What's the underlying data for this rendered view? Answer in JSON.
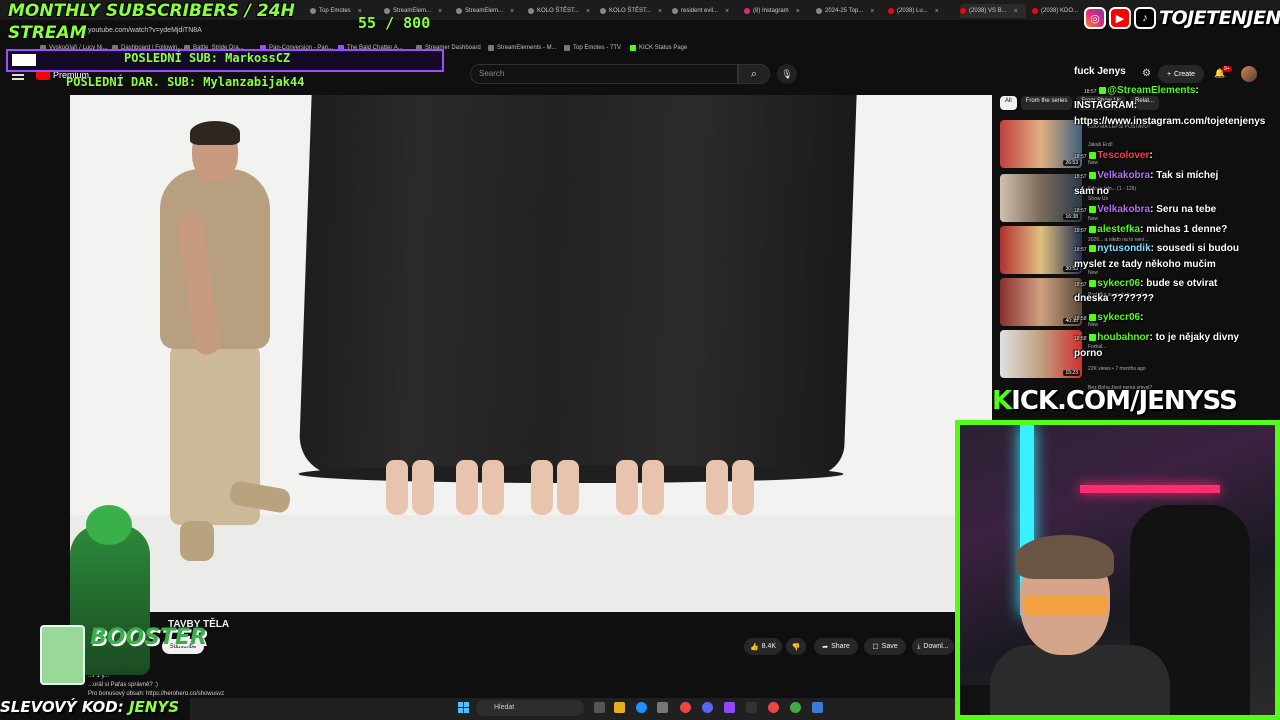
{
  "browser": {
    "tabs": [
      {
        "label": "Top Emotes"
      },
      {
        "label": "StreamElem..."
      },
      {
        "label": "StreamElem..."
      },
      {
        "label": "KOLO ŠTĚST..."
      },
      {
        "label": "KOLO ŠTĚST..."
      },
      {
        "label": "resident evil..."
      },
      {
        "label": "(8) Instagram"
      },
      {
        "label": "2024-25 Top..."
      },
      {
        "label": "(2038) Lu..."
      },
      {
        "label": "(2038) VS B..."
      },
      {
        "label": "(2038) KDO..."
      }
    ],
    "url": "youtube.com/watch?v=ydeMjdiTN8A",
    "bookmarks": [
      "Vyskočilaři / Lucy Ni...",
      "Dashboard | Followin...",
      "Battle_Stride Dra...",
      "Pan-Conversion - Pan...",
      "The Bald Chatter A...",
      "Streamer Dashboard",
      "StreamElements - M...",
      "Top Emotes - 7TV",
      "KICK Status Page"
    ]
  },
  "youtube": {
    "logo_label": "Premium",
    "search_placeholder": "Search",
    "channel_name": "fuck Jenys",
    "create_label": "Create",
    "notification_count": "9+",
    "video_title": "TAVBY TĚLA",
    "subscribe_label": "Subscribe",
    "actions": {
      "likes": "8.4K",
      "share": "Share",
      "save": "Save",
      "download": "Downl..."
    },
    "description_lines": [
      "...r 1 y...",
      "...orál si Pařas správně? :)",
      "Pro bonusový obsah: https://herohero.co/showusvz"
    ],
    "chips": [
      "All",
      "From the series",
      "From Show Us",
      "Relat..."
    ],
    "recommendations": [
      {
        "title": "KDO MÁ LEPŠÍ POSTAVU?",
        "channel": "Jakub Enžl",
        "duration": "26:53",
        "meta": "New"
      },
      {
        "title": "Kdo je kdo... (1 - 126)",
        "channel": "Show Us",
        "duration": "16:38",
        "meta": "New"
      },
      {
        "title": "2026... a nikdo na to není...",
        "channel": "",
        "duration": "30:53",
        "meta": "New"
      },
      {
        "title": "Prolétka se na tu lese.. (za...",
        "channel": "",
        "duration": "40:38",
        "meta": "New"
      },
      {
        "title": "Forbal...",
        "channel": "",
        "duration": "15:23",
        "meta": "22K views • 7 months ago"
      },
      {
        "title": "Bez Boha život nemá smysl?",
        "channel": "",
        "duration": "",
        "meta": ""
      }
    ]
  },
  "overlay": {
    "monthly_label": "MONTHLY SUBSCRIBERS / 24H",
    "stream_label": "STREAM",
    "goal_current": "55",
    "goal_total": "800",
    "last_sub": "POSLEDNÍ SUB: MarkossCZ",
    "last_dar": "POSLEDNÍ DAR. SUB: Mylanzabijak44",
    "handle": "TOJETENJENYS",
    "kick_url_prefix": "K",
    "kick_url_rest": "ICK.COM/JENYSS",
    "code_label": "SLEVOVÝ KOD: ",
    "code_value": "JENYS",
    "mascot_logo": "BOOSTER",
    "taskbar_search": "Hledat"
  },
  "chat": {
    "messages": [
      {
        "time": "",
        "user": "INSTAGRAM:",
        "text": "",
        "user_class": "u-white"
      },
      {
        "time": "18:57",
        "user": "@StreamElements",
        "text": ":",
        "user_class": "u-green"
      },
      {
        "time": "",
        "user": "",
        "text": "https://www.instagram.com/tojetenjenys",
        "user_class": "u-white"
      },
      {
        "time": "18:57",
        "user": "Tescolover",
        "text": ":",
        "user_class": "u-red"
      },
      {
        "time": "18:57",
        "user": "Velkakobra",
        "text": ": Tak si míchej",
        "user_class": "u-purple"
      },
      {
        "time": "",
        "user": "",
        "text": "sám no",
        "user_class": "u-white"
      },
      {
        "time": "18:57",
        "user": "Velkakobra",
        "text": ": Seru na tebe",
        "user_class": "u-purple"
      },
      {
        "time": "18:57",
        "user": "alestefka",
        "text": ": michas 1 denne?",
        "user_class": "u-green"
      },
      {
        "time": "18:57",
        "user": "nytusondik",
        "text": ": sousedi si budou",
        "user_class": "u-cyan"
      },
      {
        "time": "",
        "user": "",
        "text": "myslet ze tady někoho mučim",
        "user_class": "u-white"
      },
      {
        "time": "18:57",
        "user": "sykecr06",
        "text": ": bude se otvirat",
        "user_class": "u-green"
      },
      {
        "time": "",
        "user": "",
        "text": "dneska ???????",
        "user_class": "u-white"
      },
      {
        "time": "18:58",
        "user": "sykecr06",
        "text": ":",
        "user_class": "u-green"
      },
      {
        "time": "18:58",
        "user": "houbahnor",
        "text": ": to je nějaky divny",
        "user_class": "u-green"
      },
      {
        "time": "",
        "user": "",
        "text": "porno",
        "user_class": "u-white"
      }
    ]
  },
  "colors": {
    "overlay_green": "#8cff3c",
    "kick_green": "#53fc18",
    "overlay_purple": "#9b4dff",
    "youtube_bg": "#0f0f0f"
  }
}
